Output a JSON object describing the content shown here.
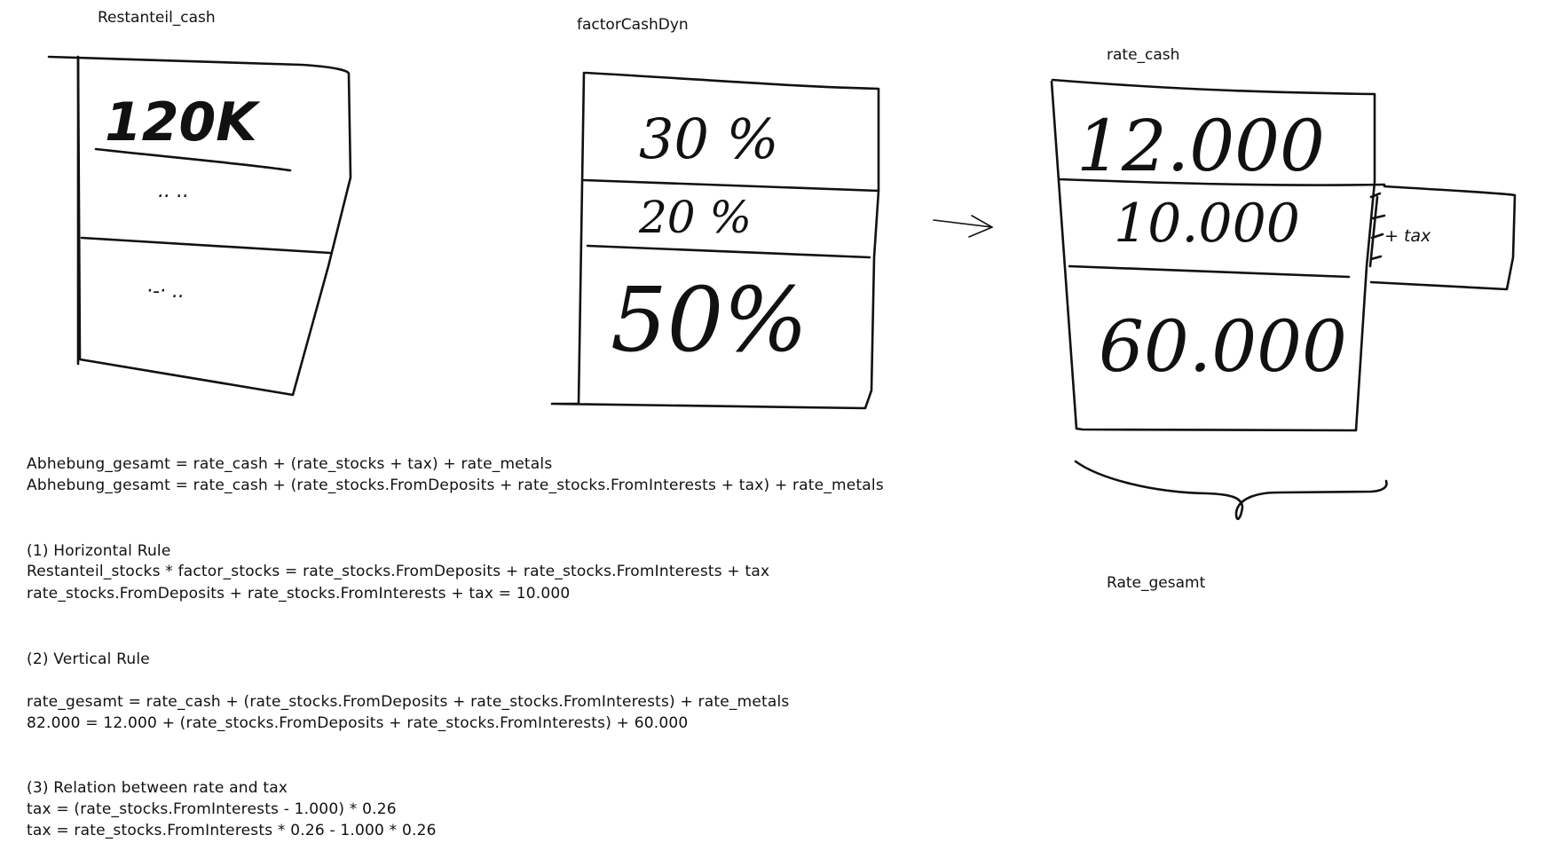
{
  "box1": {
    "title": "Restanteil_cash",
    "cells": [
      "120K",
      ".. ..",
      "·-· .."
    ]
  },
  "box2": {
    "title": "factorCashDyn",
    "cells": [
      "30 %",
      "20 %",
      "50%"
    ]
  },
  "box3": {
    "title": "rate_cash",
    "cells": [
      "12.000",
      "10.000",
      "60.000"
    ],
    "tax_label": "+ tax",
    "brace_label": "Rate_gesamt"
  },
  "formulas": {
    "line1": "Abhebung_gesamt = rate_cash + (rate_stocks + tax) + rate_metals",
    "line2": "Abhebung_gesamt = rate_cash + (rate_stocks.FromDeposits + rate_stocks.FromInterests + tax) + rate_metals"
  },
  "rule1": {
    "heading": "(1) Horizontal Rule",
    "line1": "Restanteil_stocks * factor_stocks = rate_stocks.FromDeposits + rate_stocks.FromInterests + tax",
    "line2": "rate_stocks.FromDeposits + rate_stocks.FromInterests + tax = 10.000"
  },
  "rule2": {
    "heading": "(2) Vertical Rule",
    "line1": "rate_gesamt = rate_cash + (rate_stocks.FromDeposits + rate_stocks.FromInterests) + rate_metals",
    "line2": "82.000 = 12.000 + (rate_stocks.FromDeposits + rate_stocks.FromInterests) + 60.000"
  },
  "rule3": {
    "heading": "(3) Relation between rate and tax",
    "line1": "tax = (rate_stocks.FromInterests - 1.000) * 0.26",
    "line2": "tax = rate_stocks.FromInterests * 0.26 - 1.000 * 0.26"
  }
}
